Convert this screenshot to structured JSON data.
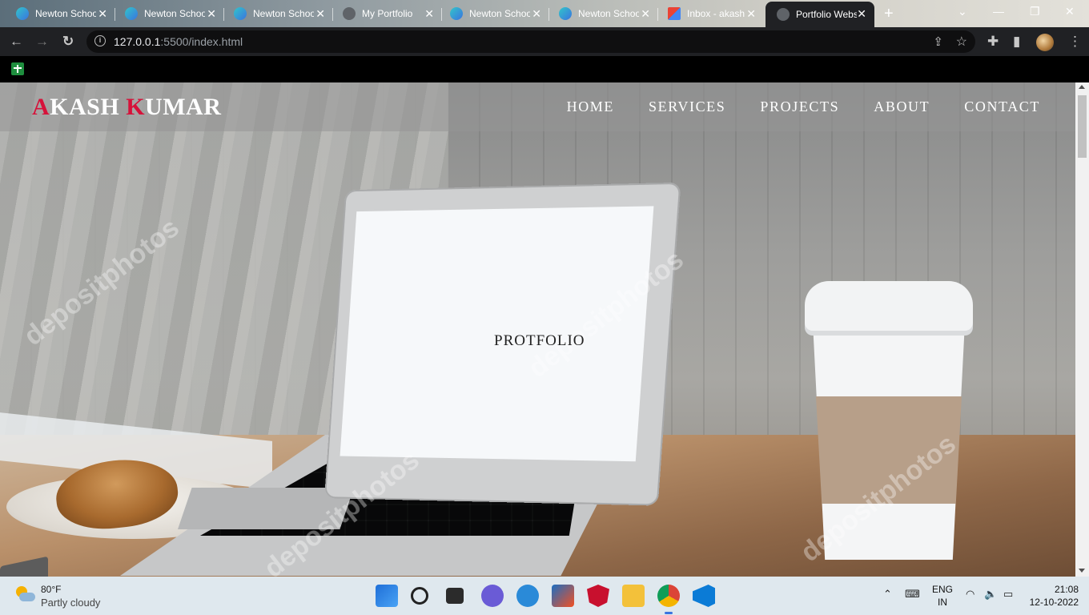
{
  "browser": {
    "tabs": [
      {
        "title": "Newton School",
        "favicon": "newton-icon",
        "active": false
      },
      {
        "title": "Newton School",
        "favicon": "newton-icon",
        "active": false
      },
      {
        "title": "Newton School",
        "favicon": "newton-icon",
        "active": false
      },
      {
        "title": "My Portfolio",
        "favicon": "github-icon",
        "active": false
      },
      {
        "title": "Newton School",
        "favicon": "newton-icon",
        "active": false
      },
      {
        "title": "Newton School",
        "favicon": "newton-icon",
        "active": false
      },
      {
        "title": "Inbox - akash",
        "favicon": "gmail-icon",
        "active": false
      },
      {
        "title": "Portfolio Website",
        "favicon": "globe-icon",
        "active": true
      }
    ],
    "url_host": "127.0.0.1",
    "url_path": ":5500/index.html"
  },
  "site": {
    "logo": {
      "first_initial": "A",
      "first_rest": "KASH ",
      "last_initial": "K",
      "last_rest": "UMAR"
    },
    "nav": [
      "HOME",
      "SERVICES",
      "PROJECTS",
      "ABOUT",
      "CONTACT"
    ],
    "hero_text": "PROTFOLIO",
    "watermark": "depositphotos"
  },
  "taskbar": {
    "weather_temp": "80°F",
    "weather_desc": "Partly cloudy",
    "lang_top": "ENG",
    "lang_bottom": "IN",
    "time": "21:08",
    "date": "12-10-2022"
  },
  "colors": {
    "accent_red": "#d6123a",
    "nav_overlay": "#969696"
  }
}
